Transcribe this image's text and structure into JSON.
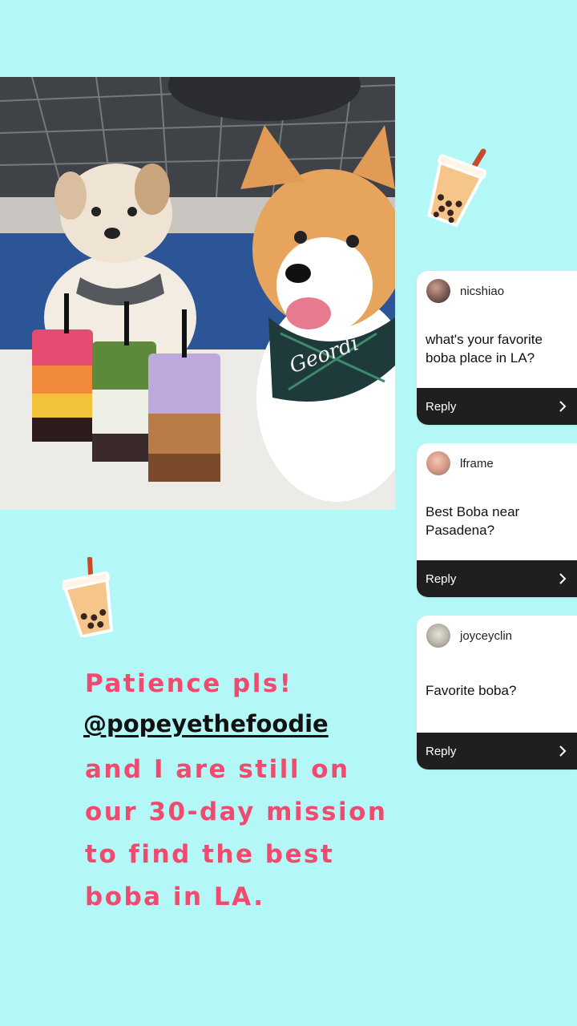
{
  "story": {
    "questions": [
      {
        "username": "nicshiao",
        "question": "what's your favorite boba place in LA?",
        "reply_label": "Reply"
      },
      {
        "username": "lframe",
        "question": "Best Boba near Pasadena?",
        "reply_label": "Reply"
      },
      {
        "username": "joyceyclin",
        "question": "Favorite boba?",
        "reply_label": "Reply"
      }
    ],
    "caption": {
      "line1": "Patience pls!",
      "mention": "@popeyethefoodie",
      "line3": "and I are still on",
      "line4": "our 30-day mission",
      "line5": "to find the best",
      "line6": "boba in LA."
    },
    "photo": {
      "bandana_text": "Geordi"
    },
    "colors": {
      "background": "#b3f7f7",
      "caption_pink": "#f04a6e",
      "reply_bar": "#1f1f1f"
    },
    "icons": [
      "boba-sticker-icon",
      "chevron-right-icon"
    ]
  }
}
